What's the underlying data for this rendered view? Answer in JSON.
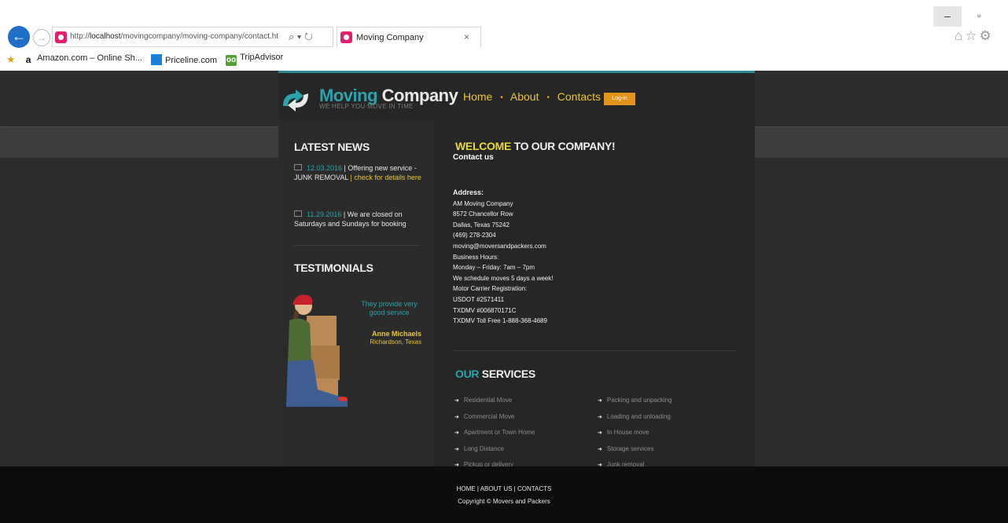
{
  "browser": {
    "url": "http://localhost/movingcompany/moving-company/contact.ht",
    "url_host": "http://",
    "url_domain": "localhost",
    "url_path": "/movingcompany/moving-company/contact.ht",
    "tab_title": "Moving Company",
    "tab_close": "×",
    "address_icons": "⌕ ▾ ↻",
    "window_min": "–",
    "window_max": "▫",
    "toolbar_icons": "⌂☆⚙",
    "favorites": [
      "Amazon.com – Online Sh...",
      "Priceline.com",
      "TripAdvisor"
    ]
  },
  "site": {
    "logo_title_a": "Moving",
    "logo_title_b": " Company",
    "logo_tagline": "WE HELP YOU MOVE IN TIME",
    "nav": [
      "Home",
      "About",
      "Contacts"
    ],
    "nav_sep": "•",
    "login_label": "Log-in",
    "colors": {
      "accent_teal": "#2aa3ad",
      "accent_yellow": "#e8c53b",
      "accent_orange": "#e4931a",
      "background": "#2d2d2d"
    }
  },
  "sidebar": {
    "news_title": "LATEST NEWS",
    "news": [
      {
        "date": "12.03.2016",
        "sep": " | ",
        "text": "Offering new service - JUNK REMOVAL",
        "link": " | check for details here"
      },
      {
        "date": "11.29.2016",
        "sep": " | ",
        "text": "We are closed on Saturdays and Sundays for booking"
      }
    ],
    "testimonials_title": "TESTIMONIALS",
    "testimonial": {
      "quote": "They provide very good service",
      "name": "Anne Michaels",
      "location": "Richardson, Texas"
    }
  },
  "content": {
    "welcome_a": "WELCOME",
    "welcome_b": " TO OUR COMPANY!",
    "contact_heading": "Contact us",
    "address_label": "Address:",
    "address_lines": [
      "AM Moving Company",
      "8572 Chancellor Row",
      "Dallas, Texas 75242",
      "(469) 278-2304",
      "moving@moversandpackers.com",
      "Business Hours:",
      "Monday – Friday: 7am – 7pm",
      "We schedule moves 5 days a week!",
      "Motor Carrier Registration:",
      "USDOT #2571411",
      "TXDMV #006870171C",
      "TXDMV Toll Free 1-888-368-4689"
    ],
    "services_a": "OUR",
    "services_b": " SERVICES",
    "services_left": [
      "Residential Move",
      "Commercial Move",
      "Apartment or Town Home",
      "Long Distance",
      "Pickup or delivery"
    ],
    "services_right": [
      "Packing and unpacking",
      "Loading and unloading",
      "In House move",
      "Storage services",
      "Junk removal"
    ]
  },
  "footer": {
    "links": [
      "HOME",
      "ABOUT US",
      "CONTACTS"
    ],
    "link_sep": " | ",
    "copyright": "Copyright © Movers and Packers"
  }
}
